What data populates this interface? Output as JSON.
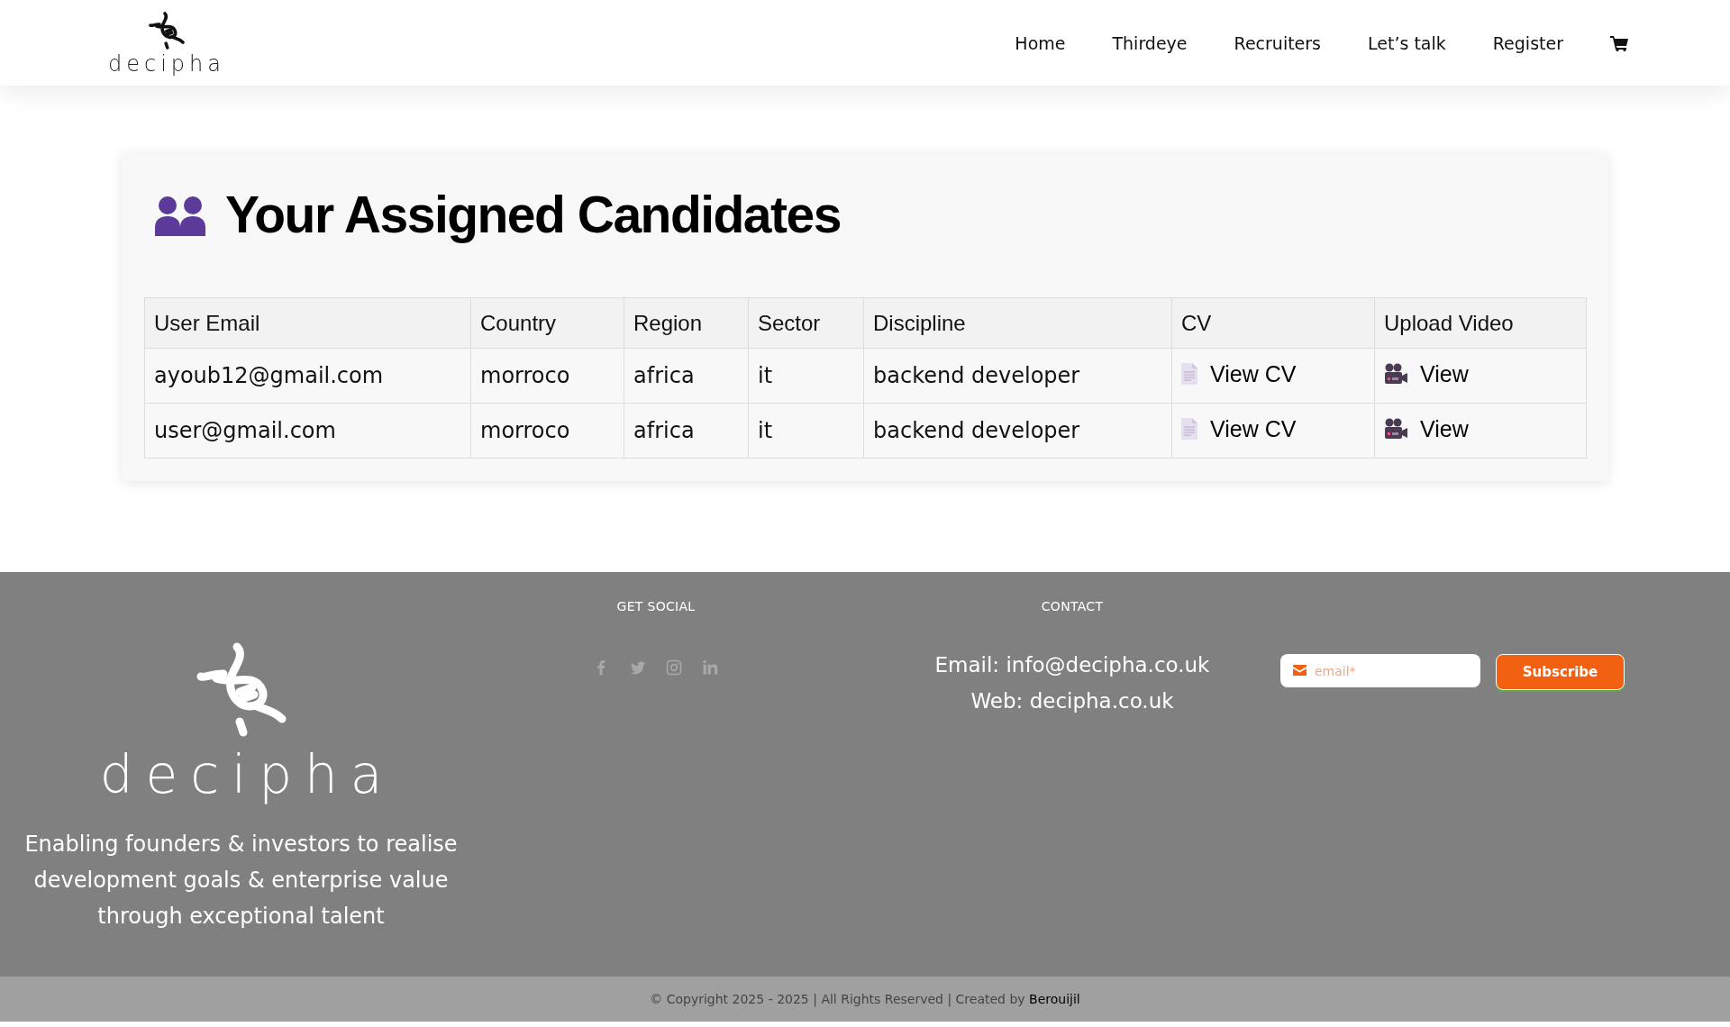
{
  "header": {
    "logo_text": "decipha",
    "nav": [
      "Home",
      "Thirdeye",
      "Recruiters",
      "Let’s talk",
      "Register"
    ]
  },
  "candidates": {
    "title": "Your Assigned Candidates",
    "columns": [
      "User Email",
      "Country",
      "Region",
      "Sector",
      "Discipline",
      "CV",
      "Upload Video"
    ],
    "rows": [
      {
        "email": "ayoub12@gmail.com",
        "country": "morroco",
        "region": "africa",
        "sector": "it",
        "discipline": "backend developer",
        "cv_link": "View CV",
        "video_link": "View"
      },
      {
        "email": "user@gmail.com",
        "country": "morroco",
        "region": "africa",
        "sector": "it",
        "discipline": "backend developer",
        "cv_link": "View CV",
        "video_link": "View"
      }
    ]
  },
  "footer": {
    "logo_text": "decipha",
    "tagline": "Enabling founders & investors to realise development goals & enterprise value through exceptional talent",
    "social": {
      "heading": "GET SOCIAL"
    },
    "contact": {
      "heading": "CONTACT",
      "email": "Email: info@decipha.co.uk",
      "web": "Web: decipha.co.uk"
    },
    "newsletter": {
      "placeholder": "email*",
      "button": "Subscribe"
    }
  },
  "copyright": {
    "text": "© Copyright 2025 - 2025 | All Rights Reserved | Created by",
    "author": "Berouijil"
  }
}
